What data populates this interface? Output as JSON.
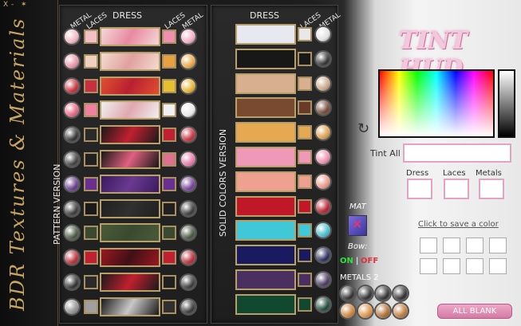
{
  "topbar": {
    "close": "X",
    "minimize": "-"
  },
  "brand": {
    "text": "BDR Textures & Materials"
  },
  "pattern": {
    "version_label": "PATTERN VERSION",
    "col_metal_left": "METAL",
    "col_laces_left": "LACES",
    "col_dress": "DRESS",
    "col_laces_right": "LACES",
    "col_metal_right": "METAL",
    "rows": [
      {
        "ml": "#f0b0c0",
        "ll": "#f4c0c8",
        "d1": "#f4d8d8",
        "d2": "#e88aa0",
        "lr": "#f090b0",
        "mr": "#f2a8c0"
      },
      {
        "ml": "#e68a9e",
        "ll": "#f0d0c0",
        "d1": "#f4dcd0",
        "d2": "#e0a0a0",
        "lr": "#e8a040",
        "mr": "#e6a038"
      },
      {
        "ml": "#c0202a",
        "ll": "#c83040",
        "d1": "#e05030",
        "d2": "#b82030",
        "lr": "#e6c030",
        "mr": "#e0b020"
      },
      {
        "ml": "#e05a78",
        "ll": "#f080a0",
        "d1": "#f0f0f0",
        "d2": "#e0a8b0",
        "lr": "#f0f0f0",
        "mr": "#e8e8e8"
      },
      {
        "ml": "#202020",
        "ll": "#2a2a2a",
        "d1": "#1a1a1a",
        "d2": "#c02030",
        "lr": "#c02030",
        "mr": "#c02030"
      },
      {
        "ml": "#303030",
        "ll": "#202020",
        "d1": "#181818",
        "d2": "#e06080",
        "lr": "#e07090",
        "mr": "#e070a0"
      },
      {
        "ml": "#5a2a80",
        "ll": "#6a3090",
        "d1": "#3a1a60",
        "d2": "#6a3a90",
        "lr": "#6a3090",
        "mr": "#6a3090"
      },
      {
        "ml": "#2a2a2a",
        "ll": "#1a1a1a",
        "d1": "#202020",
        "d2": "#303030",
        "lr": "#202020",
        "mr": "#2a2a2a"
      },
      {
        "ml": "#3a4a30",
        "ll": "#3a4a30",
        "d1": "#4a5a38",
        "d2": "#3a4a30",
        "lr": "#3a4a30",
        "mr": "#3a4a30"
      },
      {
        "ml": "#b01e28",
        "ll": "#c02030",
        "d1": "#9a1820",
        "d2": "#401018",
        "lr": "#c02030",
        "mr": "#b01e28"
      },
      {
        "ml": "#202020",
        "ll": "#2a2a2a",
        "d1": "#1a1a1a",
        "d2": "#c02030",
        "lr": "#202020",
        "mr": "#2a2a2a"
      },
      {
        "ml": "#8a8a8a",
        "ll": "#a0a0a0",
        "d1": "#1a1a1a",
        "d2": "#c8c8c8",
        "lr": "#303030",
        "mr": "#2a2a2a"
      }
    ]
  },
  "solid": {
    "version_label": "SOLID COLORS VERSION",
    "col_dress": "DRESS",
    "col_laces": "LACES",
    "col_metal": "METAL",
    "rows": [
      {
        "d": "#e8e8f0",
        "l": "#e8e8e8",
        "m": "#e0e0e0"
      },
      {
        "d": "#181818",
        "l": "#181818",
        "m": "#222222"
      },
      {
        "d": "#d8b090",
        "l": "#d8b090",
        "m": "#c8a080"
      },
      {
        "d": "#7a4a30",
        "l": "#6a3a28",
        "m": "#6a3a28"
      },
      {
        "d": "#e6a850",
        "l": "#e6a850",
        "m": "#d89840"
      },
      {
        "d": "#f098b8",
        "l": "#f098b8",
        "m": "#e888a8"
      },
      {
        "d": "#f0a090",
        "l": "#f0a090",
        "m": "#e89080"
      },
      {
        "d": "#c01828",
        "l": "#c01828",
        "m": "#b01020"
      },
      {
        "d": "#40c8d8",
        "l": "#40c8d8",
        "m": "#38b8c8"
      },
      {
        "d": "#1a1a60",
        "l": "#1a1a60",
        "m": "#1a1a50"
      },
      {
        "d": "#4a3060",
        "l": "#4a3060",
        "m": "#3a2850"
      },
      {
        "d": "#104830",
        "l": "#104830",
        "m": "#0a3a28"
      }
    ]
  },
  "tint": {
    "title": "TINT HUD",
    "tint_all_label": "Tint All",
    "dress_label": "Dress",
    "laces_label": "Laces",
    "metals_label": "Metals",
    "mat_label": "MAT",
    "bow_label": "Bow:",
    "bow_on": "ON",
    "bow_off": "OFF",
    "metals2_label": "METALS 2",
    "save_hint": "Click to save a color",
    "all_blank": "ALL BLANK",
    "metals2_colors": [
      "#202020",
      "#202020",
      "#202020",
      "#202020",
      "#c8782a",
      "#d88a38",
      "#a86420",
      "#b8702a"
    ]
  },
  "accent": "#e8a4c4"
}
